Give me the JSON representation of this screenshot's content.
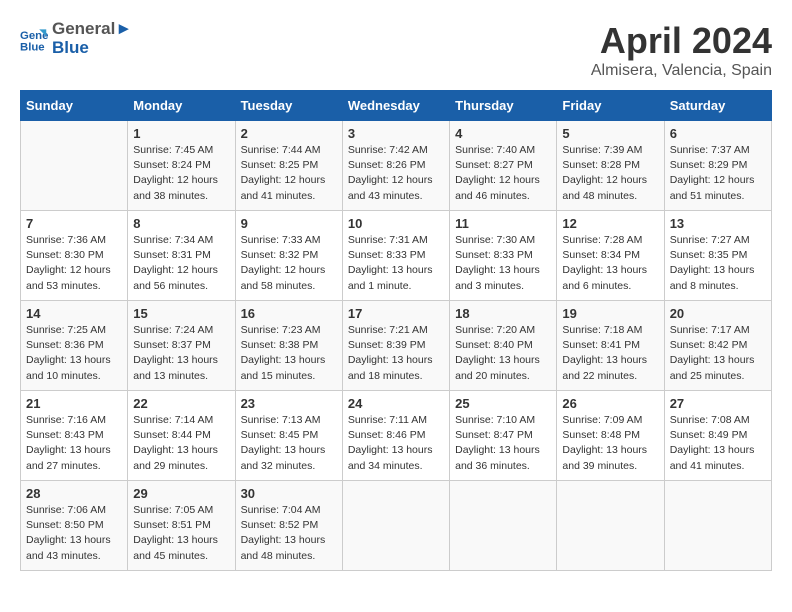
{
  "header": {
    "logo_line1": "General",
    "logo_line2": "Blue",
    "month": "April 2024",
    "location": "Almisera, Valencia, Spain"
  },
  "weekdays": [
    "Sunday",
    "Monday",
    "Tuesday",
    "Wednesday",
    "Thursday",
    "Friday",
    "Saturday"
  ],
  "weeks": [
    [
      {
        "day": "",
        "info": ""
      },
      {
        "day": "1",
        "info": "Sunrise: 7:45 AM\nSunset: 8:24 PM\nDaylight: 12 hours\nand 38 minutes."
      },
      {
        "day": "2",
        "info": "Sunrise: 7:44 AM\nSunset: 8:25 PM\nDaylight: 12 hours\nand 41 minutes."
      },
      {
        "day": "3",
        "info": "Sunrise: 7:42 AM\nSunset: 8:26 PM\nDaylight: 12 hours\nand 43 minutes."
      },
      {
        "day": "4",
        "info": "Sunrise: 7:40 AM\nSunset: 8:27 PM\nDaylight: 12 hours\nand 46 minutes."
      },
      {
        "day": "5",
        "info": "Sunrise: 7:39 AM\nSunset: 8:28 PM\nDaylight: 12 hours\nand 48 minutes."
      },
      {
        "day": "6",
        "info": "Sunrise: 7:37 AM\nSunset: 8:29 PM\nDaylight: 12 hours\nand 51 minutes."
      }
    ],
    [
      {
        "day": "7",
        "info": "Sunrise: 7:36 AM\nSunset: 8:30 PM\nDaylight: 12 hours\nand 53 minutes."
      },
      {
        "day": "8",
        "info": "Sunrise: 7:34 AM\nSunset: 8:31 PM\nDaylight: 12 hours\nand 56 minutes."
      },
      {
        "day": "9",
        "info": "Sunrise: 7:33 AM\nSunset: 8:32 PM\nDaylight: 12 hours\nand 58 minutes."
      },
      {
        "day": "10",
        "info": "Sunrise: 7:31 AM\nSunset: 8:33 PM\nDaylight: 13 hours\nand 1 minute."
      },
      {
        "day": "11",
        "info": "Sunrise: 7:30 AM\nSunset: 8:33 PM\nDaylight: 13 hours\nand 3 minutes."
      },
      {
        "day": "12",
        "info": "Sunrise: 7:28 AM\nSunset: 8:34 PM\nDaylight: 13 hours\nand 6 minutes."
      },
      {
        "day": "13",
        "info": "Sunrise: 7:27 AM\nSunset: 8:35 PM\nDaylight: 13 hours\nand 8 minutes."
      }
    ],
    [
      {
        "day": "14",
        "info": "Sunrise: 7:25 AM\nSunset: 8:36 PM\nDaylight: 13 hours\nand 10 minutes."
      },
      {
        "day": "15",
        "info": "Sunrise: 7:24 AM\nSunset: 8:37 PM\nDaylight: 13 hours\nand 13 minutes."
      },
      {
        "day": "16",
        "info": "Sunrise: 7:23 AM\nSunset: 8:38 PM\nDaylight: 13 hours\nand 15 minutes."
      },
      {
        "day": "17",
        "info": "Sunrise: 7:21 AM\nSunset: 8:39 PM\nDaylight: 13 hours\nand 18 minutes."
      },
      {
        "day": "18",
        "info": "Sunrise: 7:20 AM\nSunset: 8:40 PM\nDaylight: 13 hours\nand 20 minutes."
      },
      {
        "day": "19",
        "info": "Sunrise: 7:18 AM\nSunset: 8:41 PM\nDaylight: 13 hours\nand 22 minutes."
      },
      {
        "day": "20",
        "info": "Sunrise: 7:17 AM\nSunset: 8:42 PM\nDaylight: 13 hours\nand 25 minutes."
      }
    ],
    [
      {
        "day": "21",
        "info": "Sunrise: 7:16 AM\nSunset: 8:43 PM\nDaylight: 13 hours\nand 27 minutes."
      },
      {
        "day": "22",
        "info": "Sunrise: 7:14 AM\nSunset: 8:44 PM\nDaylight: 13 hours\nand 29 minutes."
      },
      {
        "day": "23",
        "info": "Sunrise: 7:13 AM\nSunset: 8:45 PM\nDaylight: 13 hours\nand 32 minutes."
      },
      {
        "day": "24",
        "info": "Sunrise: 7:11 AM\nSunset: 8:46 PM\nDaylight: 13 hours\nand 34 minutes."
      },
      {
        "day": "25",
        "info": "Sunrise: 7:10 AM\nSunset: 8:47 PM\nDaylight: 13 hours\nand 36 minutes."
      },
      {
        "day": "26",
        "info": "Sunrise: 7:09 AM\nSunset: 8:48 PM\nDaylight: 13 hours\nand 39 minutes."
      },
      {
        "day": "27",
        "info": "Sunrise: 7:08 AM\nSunset: 8:49 PM\nDaylight: 13 hours\nand 41 minutes."
      }
    ],
    [
      {
        "day": "28",
        "info": "Sunrise: 7:06 AM\nSunset: 8:50 PM\nDaylight: 13 hours\nand 43 minutes."
      },
      {
        "day": "29",
        "info": "Sunrise: 7:05 AM\nSunset: 8:51 PM\nDaylight: 13 hours\nand 45 minutes."
      },
      {
        "day": "30",
        "info": "Sunrise: 7:04 AM\nSunset: 8:52 PM\nDaylight: 13 hours\nand 48 minutes."
      },
      {
        "day": "",
        "info": ""
      },
      {
        "day": "",
        "info": ""
      },
      {
        "day": "",
        "info": ""
      },
      {
        "day": "",
        "info": ""
      }
    ]
  ]
}
